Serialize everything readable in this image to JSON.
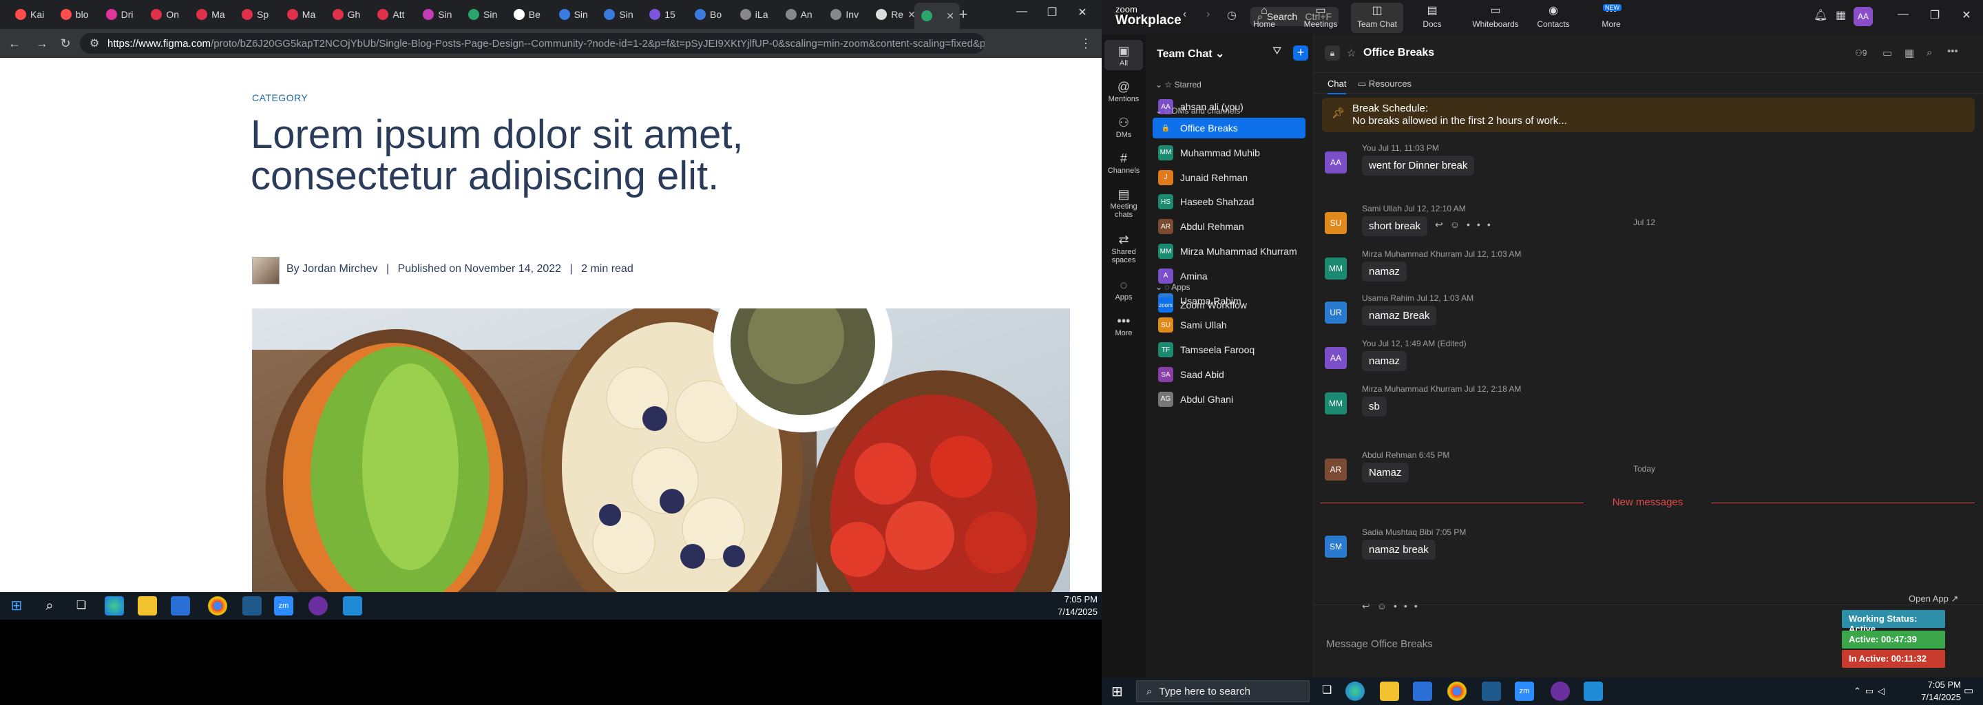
{
  "browser": {
    "tabs": [
      {
        "label": "Kai",
        "color": "#ff4d4d"
      },
      {
        "label": "blo",
        "color": "#ff4d4d"
      },
      {
        "label": "Dri",
        "color": "#e0359a"
      },
      {
        "label": "On",
        "color": "#e0304a"
      },
      {
        "label": "Ma",
        "color": "#e0304a"
      },
      {
        "label": "Sp",
        "color": "#e0304a"
      },
      {
        "label": "Ma",
        "color": "#e0304a"
      },
      {
        "label": "Gh",
        "color": "#e0304a"
      },
      {
        "label": "Att",
        "color": "#e0304a"
      },
      {
        "label": "Sin",
        "color": "#c43db8"
      },
      {
        "label": "Sin",
        "color": "#2aa56d"
      },
      {
        "label": "Be",
        "color": "#ffffff"
      },
      {
        "label": "Sin",
        "color": "#3a7be0"
      },
      {
        "label": "Sin",
        "color": "#3a7be0"
      },
      {
        "label": "15",
        "color": "#7b55e0"
      },
      {
        "label": "Bo",
        "color": "#3a7be0"
      },
      {
        "label": "iLa",
        "color": "#888888"
      },
      {
        "label": "An",
        "color": "#888888"
      },
      {
        "label": "Inv",
        "color": "#888888"
      },
      {
        "label": "Re",
        "color": "#dddddd"
      },
      {
        "label": "",
        "color": "#2aa56d"
      }
    ],
    "new_tab": "+",
    "url_host": "https://www.figma.com",
    "url_path": "/proto/bZ6J20GG5kapT2NCOjYbUb/Single-Blog-Posts-Page-Design--Community-?node-id=1-2&p=f&t=pSyJEI9XKtYjlfUP-0&scaling=min-zoom&content-scaling=fixed&pa...",
    "profile_initial": "B"
  },
  "blog": {
    "category": "CATEGORY",
    "title_line1": "Lorem ipsum dolor sit amet,",
    "title_line2": "consectetur adipiscing elit.",
    "author": "By Jordan Mirchev",
    "published": "Published on November 14, 2022",
    "read_time": "2 min read",
    "separator": "|"
  },
  "left_taskbar": {
    "time": "7:05 PM",
    "date": "7/14/2025"
  },
  "zoom": {
    "logo_top": "zoom",
    "logo_bottom": "Workplace",
    "search_label": "Search",
    "search_shortcut": "Ctrl+F",
    "nav": [
      {
        "label": "Home",
        "icon": "⌂"
      },
      {
        "label": "Meetings",
        "icon": "▭"
      },
      {
        "label": "Team Chat",
        "icon": "◫"
      },
      {
        "label": "Docs",
        "icon": "▤"
      },
      {
        "label": "Whiteboards",
        "icon": "▭"
      },
      {
        "label": "Contacts",
        "icon": "◉"
      },
      {
        "label": "More",
        "icon": "•••"
      }
    ],
    "new_badge": "NEW",
    "user_initials": "AA",
    "rail": [
      {
        "label": "All",
        "icon": "▣"
      },
      {
        "label": "Mentions",
        "icon": "@"
      },
      {
        "label": "DMs",
        "icon": "⚇"
      },
      {
        "label": "Channels",
        "icon": "#"
      },
      {
        "label": "Meeting chats",
        "icon": "▤"
      },
      {
        "label": "Shared spaces",
        "icon": "⇄"
      },
      {
        "label": "Apps",
        "icon": "◌"
      },
      {
        "label": "More",
        "icon": "•••"
      }
    ],
    "list_title": "Team Chat",
    "sections": {
      "starred": "Starred",
      "dms": "DMs and channels",
      "apps": "Apps"
    },
    "self_item": {
      "name": "ahsan ali (you)",
      "initials": "AA",
      "color": "#7b4fc8"
    },
    "contacts": [
      {
        "name": "Office Breaks",
        "initials": "🔒",
        "color": "#0e71eb"
      },
      {
        "name": "Muhammad Muhib",
        "initials": "MM",
        "color": "#1b8a70"
      },
      {
        "name": "Junaid Rehman",
        "initials": "J",
        "color": "#e07a1c"
      },
      {
        "name": "Haseeb Shahzad",
        "initials": "HS",
        "color": "#1b8a70"
      },
      {
        "name": "Abdul Rehman",
        "initials": "AR",
        "color": "#7a4a32"
      },
      {
        "name": "Mirza Muhammad Khurram",
        "initials": "MM",
        "color": "#1b8a70"
      },
      {
        "name": "Amina",
        "initials": "A",
        "color": "#7b4fc8"
      },
      {
        "name": "Usama Rahim",
        "initials": "UR",
        "color": "#2a7bd0"
      },
      {
        "name": "Sami Ullah",
        "initials": "SU",
        "color": "#e08a1c"
      },
      {
        "name": "Tamseela Farooq",
        "initials": "TF",
        "color": "#1b8a70"
      },
      {
        "name": "Saad Abid",
        "initials": "SA",
        "color": "#8a3fa8"
      },
      {
        "name": "Abdul Ghani",
        "initials": "AG",
        "color": "#777777"
      }
    ],
    "app_item": {
      "name": "Zoom Workflow",
      "initials": "zoom",
      "color": "#0e71eb"
    },
    "channel_title": "Office Breaks",
    "member_count": "9",
    "tabs": {
      "chat": "Chat",
      "resources": "Resources"
    },
    "pinned_title": "Break Schedule:",
    "pinned_body": "No breaks allowed in the first 2 hours of work...",
    "messages": [
      {
        "meta": "You Jul 11, 11:03 PM",
        "text": "went for Dinner break",
        "initials": "AA",
        "color": "#7b4fc8"
      },
      {
        "meta": "Sami Ullah Jul 12, 12:10 AM",
        "text": "short break",
        "initials": "SU",
        "color": "#e08a1c"
      },
      {
        "meta": "Mirza Muhammad Khurram Jul 12, 1:03 AM",
        "text": "namaz",
        "initials": "MM",
        "color": "#1b8a70"
      },
      {
        "meta": "Usama Rahim Jul 12, 1:03 AM",
        "text": "namaz Break",
        "initials": "UR",
        "color": "#2a7bd0"
      },
      {
        "meta": "You Jul 12, 1:49 AM (Edited)",
        "text": "namaz",
        "initials": "AA",
        "color": "#7b4fc8"
      },
      {
        "meta": "Mirza Muhammad Khurram Jul 12, 2:18 AM",
        "text": "sb",
        "initials": "MM",
        "color": "#1b8a70"
      },
      {
        "meta": "Abdul Rehman 6:45 PM",
        "text": "Namaz",
        "initials": "AR",
        "color": "#7a4a32"
      },
      {
        "meta": "Sadia Mushtaq Bibi 7:05 PM",
        "text": "namaz break",
        "initials": "SM",
        "color": "#2a7bd0"
      }
    ],
    "day_jul12": "Jul 12",
    "day_today": "Today",
    "new_messages": "New messages",
    "open_app": "Open App",
    "compose_placeholder": "Message Office Breaks",
    "status": {
      "working": "Working Status: Active",
      "active": "Active: 00:47:39",
      "inactive": "In Active: 00:11:32"
    }
  },
  "right_taskbar": {
    "search_placeholder": "Type here to search",
    "time": "7:05 PM",
    "date": "7/14/2025"
  }
}
